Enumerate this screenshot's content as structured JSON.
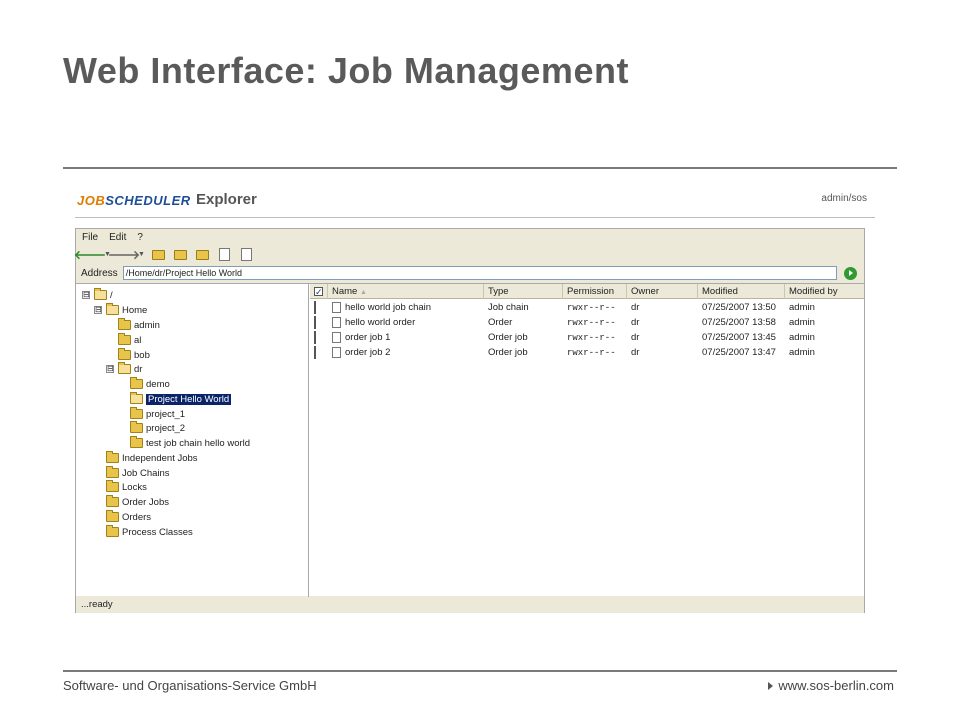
{
  "slide": {
    "title": "Web Interface: Job Management",
    "footer_left": "Software- und Organisations-Service GmbH",
    "footer_right": "www.sos-berlin.com"
  },
  "app": {
    "logo_job": "JOB",
    "logo_scheduler": "SCHEDULER",
    "name": "Explorer",
    "user": "admin/sos"
  },
  "menu": {
    "items": [
      "File",
      "Edit",
      "?"
    ]
  },
  "toolbar": {
    "icons": [
      "back-icon",
      "forward-icon",
      "folder-up-icon",
      "new-folder-icon",
      "edit-folder-icon",
      "refresh-page-icon",
      "search-page-icon"
    ]
  },
  "address": {
    "label": "Address",
    "value": "/Home/dr/Project Hello World"
  },
  "tree": {
    "items": [
      {
        "label": "/",
        "expander": "⊟"
      },
      {
        "label": "Home",
        "expander": "⊟"
      },
      {
        "label": "admin"
      },
      {
        "label": "al"
      },
      {
        "label": "bob"
      },
      {
        "label": "dr",
        "expander": "⊟"
      },
      {
        "label": "demo"
      },
      {
        "label": "Project Hello World",
        "selected": true
      },
      {
        "label": "project_1"
      },
      {
        "label": "project_2"
      },
      {
        "label": "test job chain hello world"
      },
      {
        "label": "Independent Jobs"
      },
      {
        "label": "Job Chains"
      },
      {
        "label": "Locks"
      },
      {
        "label": "Order Jobs"
      },
      {
        "label": "Orders"
      },
      {
        "label": "Process Classes"
      }
    ]
  },
  "grid": {
    "columns": [
      "Name",
      "Type",
      "Permission",
      "Owner",
      "Modified",
      "Modified by"
    ],
    "sort_marker": "▲",
    "rows": [
      {
        "name": "hello world job chain",
        "type": "Job chain",
        "permission": "rwxr--r--",
        "owner": "dr",
        "modified": "07/25/2007 13:50",
        "modified_by": "admin"
      },
      {
        "name": "hello world order",
        "type": "Order",
        "permission": "rwxr--r--",
        "owner": "dr",
        "modified": "07/25/2007 13:58",
        "modified_by": "admin"
      },
      {
        "name": "order job 1",
        "type": "Order job",
        "permission": "rwxr--r--",
        "owner": "dr",
        "modified": "07/25/2007 13:45",
        "modified_by": "admin"
      },
      {
        "name": "order job 2",
        "type": "Order job",
        "permission": "rwxr--r--",
        "owner": "dr",
        "modified": "07/25/2007 13:47",
        "modified_by": "admin"
      }
    ]
  },
  "status": {
    "text": "...ready"
  }
}
